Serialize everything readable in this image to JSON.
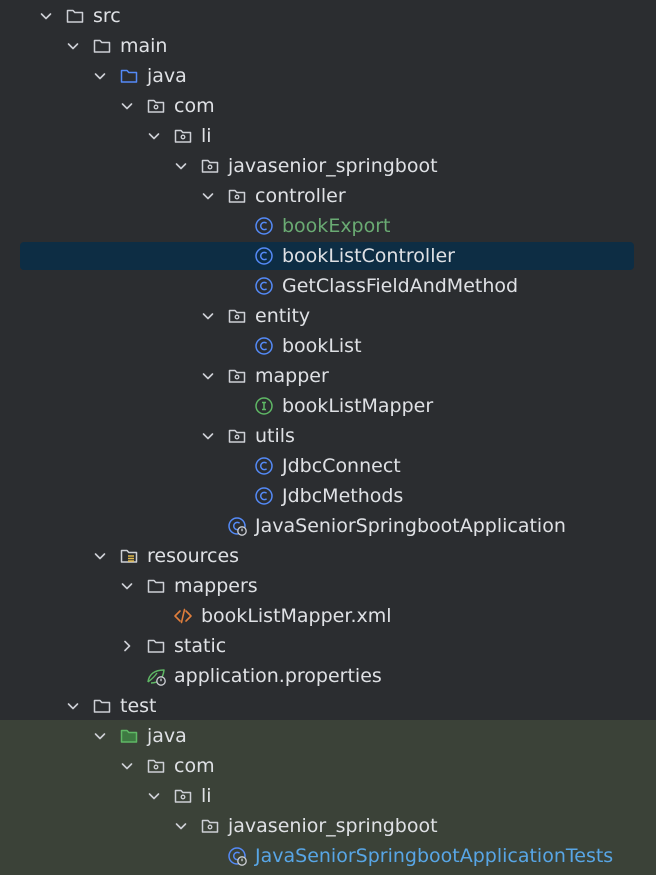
{
  "tree": {
    "items": [
      {
        "label": "src",
        "depth": 0,
        "expanded": true,
        "icon": "folder-icon",
        "hasChevron": true
      },
      {
        "label": "main",
        "depth": 1,
        "expanded": true,
        "icon": "folder-icon",
        "hasChevron": true
      },
      {
        "label": "java",
        "depth": 2,
        "expanded": true,
        "icon": "source-root-folder-icon",
        "hasChevron": true
      },
      {
        "label": "com",
        "depth": 3,
        "expanded": true,
        "icon": "package-icon",
        "hasChevron": true
      },
      {
        "label": "li",
        "depth": 4,
        "expanded": true,
        "icon": "package-icon",
        "hasChevron": true
      },
      {
        "label": "javasenior_springboot",
        "depth": 5,
        "expanded": true,
        "icon": "package-icon",
        "hasChevron": true
      },
      {
        "label": "controller",
        "depth": 6,
        "expanded": true,
        "icon": "package-icon",
        "hasChevron": true
      },
      {
        "label": "bookExport",
        "depth": 7,
        "icon": "class-icon",
        "hasChevron": false,
        "labelColor": "#6aab73"
      },
      {
        "label": "bookListController",
        "depth": 7,
        "icon": "class-icon",
        "hasChevron": false,
        "selected": true
      },
      {
        "label": "GetClassFieldAndMethod",
        "depth": 7,
        "icon": "class-icon",
        "hasChevron": false
      },
      {
        "label": "entity",
        "depth": 6,
        "expanded": true,
        "icon": "package-icon",
        "hasChevron": true
      },
      {
        "label": "bookList",
        "depth": 7,
        "icon": "class-icon",
        "hasChevron": false
      },
      {
        "label": "mapper",
        "depth": 6,
        "expanded": true,
        "icon": "package-icon",
        "hasChevron": true
      },
      {
        "label": "bookListMapper",
        "depth": 7,
        "icon": "interface-icon",
        "hasChevron": false
      },
      {
        "label": "utils",
        "depth": 6,
        "expanded": true,
        "icon": "package-icon",
        "hasChevron": true
      },
      {
        "label": "JdbcConnect",
        "depth": 7,
        "icon": "class-icon",
        "hasChevron": false
      },
      {
        "label": "JdbcMethods",
        "depth": 7,
        "icon": "class-icon",
        "hasChevron": false
      },
      {
        "label": "JavaSeniorSpringbootApplication",
        "depth": 6,
        "icon": "spring-boot-class-icon",
        "hasChevron": false
      },
      {
        "label": "resources",
        "depth": 2,
        "expanded": true,
        "icon": "resources-folder-icon",
        "hasChevron": true
      },
      {
        "label": "mappers",
        "depth": 3,
        "expanded": true,
        "icon": "folder-icon",
        "hasChevron": true
      },
      {
        "label": "bookListMapper.xml",
        "depth": 4,
        "icon": "xml-file-icon",
        "hasChevron": false
      },
      {
        "label": "static",
        "depth": 3,
        "expanded": false,
        "icon": "folder-icon",
        "hasChevron": true
      },
      {
        "label": "application.properties",
        "depth": 3,
        "icon": "spring-properties-icon",
        "hasChevron": false
      },
      {
        "label": "test",
        "depth": 1,
        "expanded": true,
        "icon": "folder-icon",
        "hasChevron": true
      },
      {
        "label": "java",
        "depth": 2,
        "expanded": true,
        "icon": "test-root-folder-icon",
        "hasChevron": true
      },
      {
        "label": "com",
        "depth": 3,
        "expanded": true,
        "icon": "package-icon",
        "hasChevron": true
      },
      {
        "label": "li",
        "depth": 4,
        "expanded": true,
        "icon": "package-icon",
        "hasChevron": true
      },
      {
        "label": "javasenior_springboot",
        "depth": 5,
        "expanded": true,
        "icon": "package-icon",
        "hasChevron": true
      },
      {
        "label": "JavaSeniorSpringbootApplicationTests",
        "depth": 6,
        "icon": "test-class-icon",
        "hasChevron": false,
        "labelColor": "#58a6e6"
      }
    ]
  },
  "colors": {
    "background": "#2b2d30",
    "text": "#dfe1e5",
    "selection": "#0d2d44",
    "testAreaBackground": "#3b4238",
    "classIconBlue": "#548af7",
    "interfaceIconGreen": "#5fb865",
    "xmlOrange": "#e07e3c",
    "springGreen": "#5fb865",
    "modifiedGreen": "#6aab73",
    "testBlue": "#58a6e6"
  }
}
